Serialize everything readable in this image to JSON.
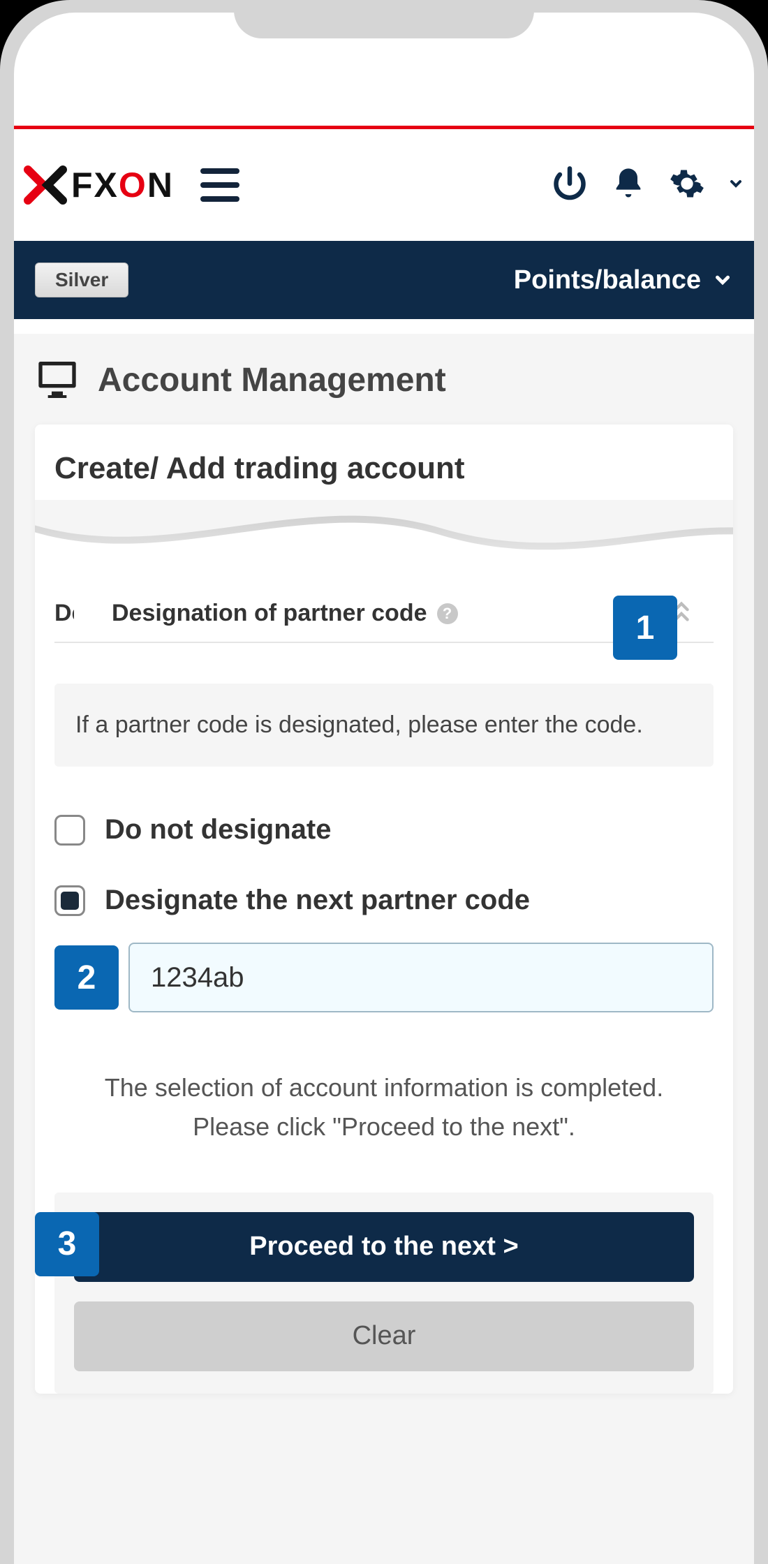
{
  "header": {
    "logo_text": "FXON",
    "tier_badge": "Silver",
    "points_balance_label": "Points/balance"
  },
  "page": {
    "title": "Account Management"
  },
  "card": {
    "title": "Create/ Add trading account",
    "section_heading_trunc": "Desi",
    "section_heading": "Designation of partner code",
    "info_text": "If a partner code is designated, please enter the code.",
    "radio_do_not": "Do not designate",
    "radio_designate_next": "Designate the next partner code",
    "partner_input_value": "1234ab",
    "completion_text": "The selection of account information is completed. Please click \"Proceed to the next\".",
    "proceed_label": "Proceed to the next >",
    "clear_label": "Clear"
  },
  "steps": {
    "one": "1",
    "two": "2",
    "three": "3"
  }
}
